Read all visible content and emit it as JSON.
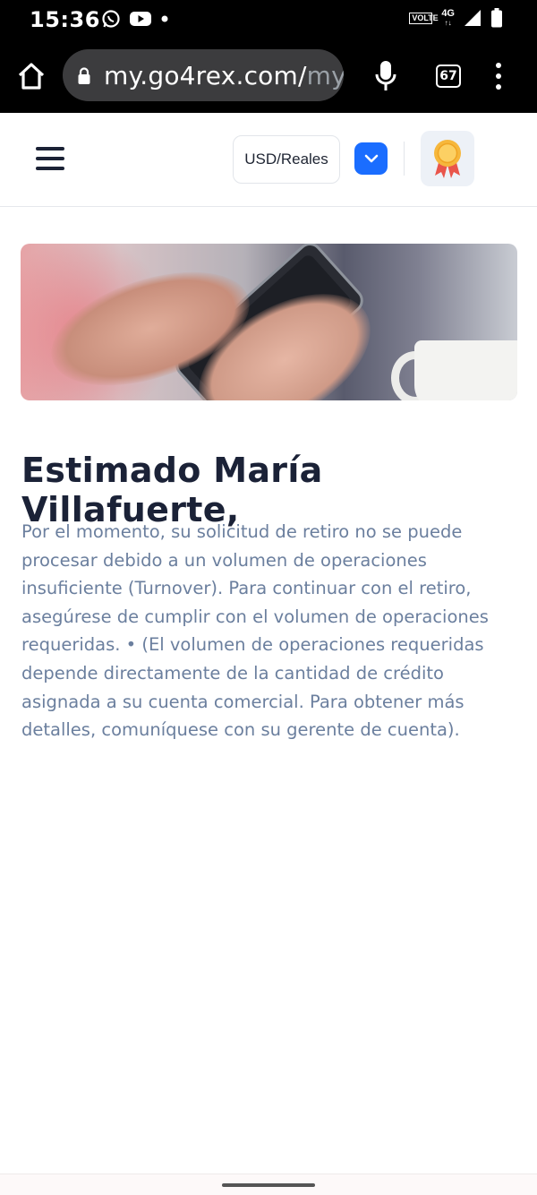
{
  "status_bar": {
    "time": "15:36",
    "app_icons": [
      "whatsapp-icon",
      "youtube-icon",
      "dot-icon"
    ],
    "volte_label": "VOLTE",
    "network_label": "4G",
    "system_icons": [
      "signal-icon",
      "battery-icon"
    ]
  },
  "browser": {
    "url_main": "my.go4rex.com/",
    "url_fade": "my",
    "tab_count": "67",
    "icons": [
      "home-icon",
      "lock-icon",
      "mic-icon",
      "tabs-icon",
      "more-vert-icon"
    ]
  },
  "header": {
    "currency_label": "USD/Reales",
    "icons": [
      "hamburger-menu-icon",
      "chevron-down-icon",
      "award-badge-icon"
    ],
    "accent_color": "#1a6dff"
  },
  "content": {
    "greeting": "Estimado María Villafuerte,",
    "message": "Por el momento, su solicitud de retiro no se puede procesar debido a un volumen de operaciones insuficiente (Turnover). Para continuar con el retiro, asegúrese de cumplir con el volumen de operaciones requeridas. • (El volumen de operaciones requeridas depende directamente de la cantidad de crédito asignada a su cuenta comercial. Para obtener más detalles, comuníquese con su gerente de cuenta)."
  },
  "colors": {
    "heading": "#1b2237",
    "body_text": "#6b7f9e"
  }
}
